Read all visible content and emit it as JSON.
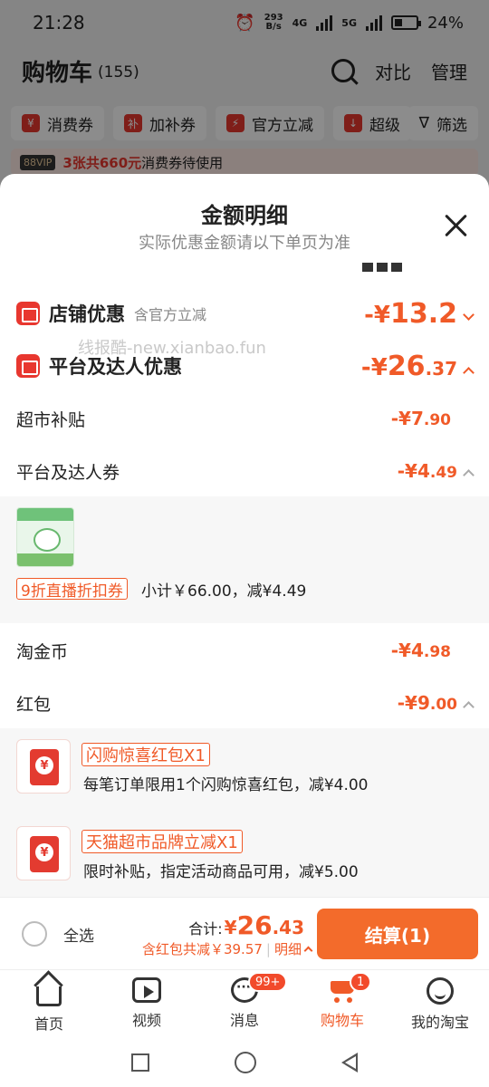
{
  "status": {
    "time": "21:28",
    "speed_value": "293",
    "speed_unit": "B/s",
    "net1": "4G",
    "net2": "5G",
    "battery": "24%"
  },
  "cart": {
    "title": "购物车",
    "count": "(155)",
    "compare": "对比",
    "manage": "管理",
    "filters": [
      {
        "badge": "¥",
        "label": "消费券"
      },
      {
        "badge": "补",
        "label": "加补券"
      },
      {
        "badge": "⚡",
        "label": "官方立减"
      },
      {
        "badge": "↓",
        "label": "超级"
      }
    ],
    "filter_btn": "筛选",
    "vip_tag": "88VIP",
    "vip_strong": "3张共660元",
    "vip_rest": "消费券待使用"
  },
  "sheet": {
    "title": "金额明细",
    "subtitle": "实际优惠金额请以下单页为准",
    "watermark": "线报酷-new.xianbao.fun",
    "store": {
      "label": "店铺优惠",
      "note": "含官方立减",
      "prefix": "-¥",
      "amount": "13.2"
    },
    "platform": {
      "label": "平台及达人优惠",
      "prefix": "-¥",
      "amount_int": "26",
      "amount_dec": ".37"
    },
    "items": [
      {
        "label": "超市补贴",
        "prefix": "-¥",
        "int": "7",
        "dec": ".90"
      },
      {
        "label": "平台及达人券",
        "prefix": "-¥",
        "int": "4",
        "dec": ".49"
      }
    ],
    "coupon": {
      "tag": "9折直播折扣券",
      "desc": "小计￥66.00，减¥4.49"
    },
    "items2": [
      {
        "label": "淘金币",
        "prefix": "-¥",
        "int": "4",
        "dec": ".98"
      },
      {
        "label": "红包",
        "prefix": "-¥",
        "int": "9",
        "dec": ".00"
      }
    ],
    "redpackets": [
      {
        "tag": "闪购惊喜红包X1",
        "desc": "每笔订单限用1个闪购惊喜红包，减¥4.00"
      },
      {
        "tag": "天猫超市品牌立减X1",
        "desc": "限时补贴，指定活动商品可用，减¥5.00"
      }
    ]
  },
  "checkout": {
    "select_all": "全选",
    "total_label": "合计:",
    "total_cur": "¥",
    "total_int": "26",
    "total_dec": ".43",
    "saved": "含红包共减￥39.57",
    "detail": "明细",
    "pay": "结算(1)"
  },
  "tabs": [
    {
      "label": "首页"
    },
    {
      "label": "视频"
    },
    {
      "label": "消息",
      "badge": "99+"
    },
    {
      "label": "购物车",
      "badge": "1"
    },
    {
      "label": "我的淘宝"
    }
  ],
  "colors": {
    "accent": "#f05a28",
    "red": "#e8372f",
    "pay": "#f36b2b"
  }
}
